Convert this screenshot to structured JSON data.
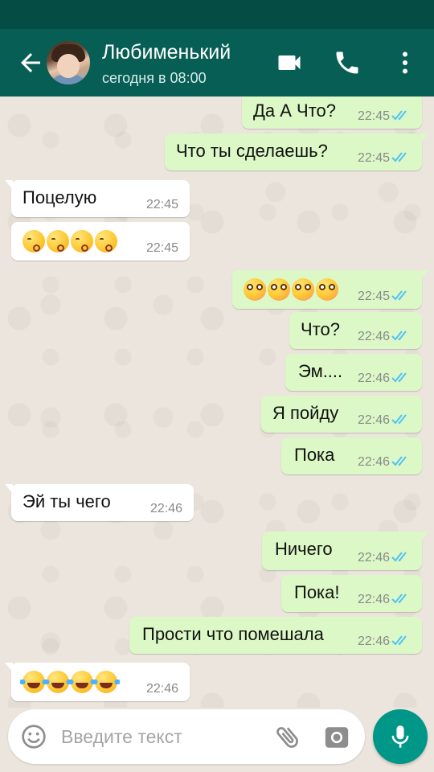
{
  "header": {
    "contact_name": "Любименький",
    "last_seen": "сегодня в 08:00",
    "icons": [
      "back-arrow-icon",
      "video-call-icon",
      "phone-call-icon",
      "more-options-icon"
    ]
  },
  "messages": [
    {
      "dir": "out",
      "text": "Да А Что?",
      "time": "22:45"
    },
    {
      "dir": "out",
      "text": "Что ты сделаешь?",
      "time": "22:45"
    },
    {
      "dir": "in",
      "text": "Поцелую",
      "time": "22:45"
    },
    {
      "dir": "in",
      "emoji": "kissing-face-closed-eyes",
      "emoji_count": 4,
      "time": "22:45"
    },
    {
      "dir": "out",
      "emoji": "flushed-face",
      "emoji_count": 4,
      "time": "22:45"
    },
    {
      "dir": "out",
      "text": "Что?",
      "time": "22:46"
    },
    {
      "dir": "out",
      "text": "Эм....",
      "time": "22:46"
    },
    {
      "dir": "out",
      "text": "Я пойду",
      "time": "22:46"
    },
    {
      "dir": "out",
      "text": "Пока",
      "time": "22:46"
    },
    {
      "dir": "in",
      "text": "Эй ты чего",
      "time": "22:46"
    },
    {
      "dir": "out",
      "text": "Ничего",
      "time": "22:46"
    },
    {
      "dir": "out",
      "text": "Пока!",
      "time": "22:46"
    },
    {
      "dir": "out",
      "text": "Прости что помешала",
      "time": "22:46"
    },
    {
      "dir": "in",
      "emoji": "face-with-tears-of-joy",
      "emoji_count": 4,
      "time": "22:46"
    }
  ],
  "composer": {
    "placeholder": "Введите текст",
    "icons": [
      "emoji-icon",
      "attach-icon",
      "camera-icon",
      "mic-icon"
    ]
  },
  "colors": {
    "header": "#075e54",
    "status_bar": "#054d44",
    "outgoing_bubble": "#dcf8c6",
    "incoming_bubble": "#ffffff",
    "read_ticks": "#4fc3f7",
    "mic_button": "#009688"
  }
}
